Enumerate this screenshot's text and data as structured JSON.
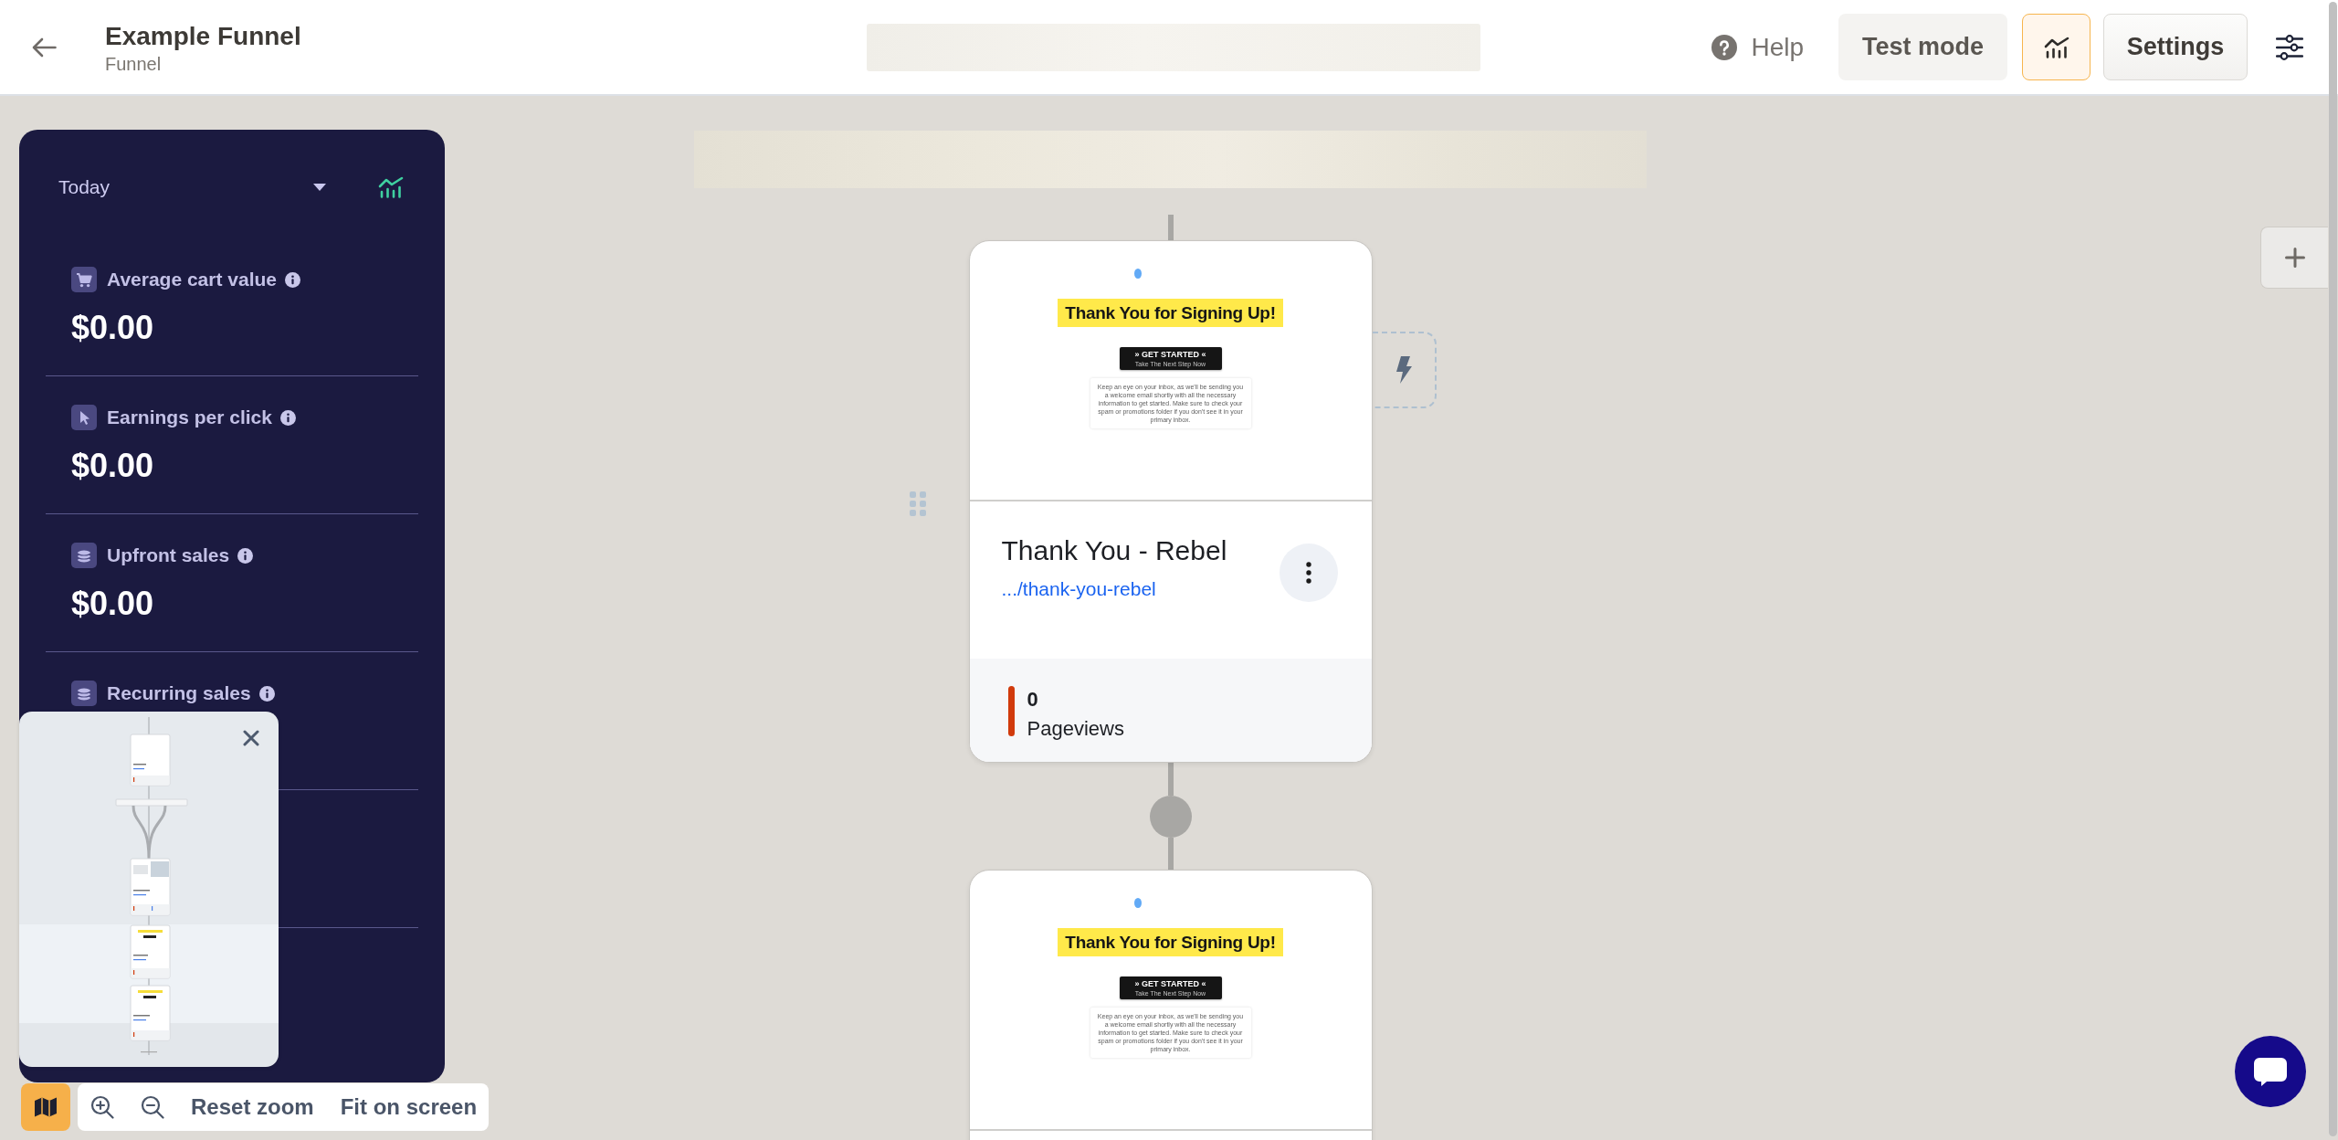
{
  "header": {
    "title": "Example Funnel",
    "subtitle": "Funnel",
    "actions": [
      {
        "kind": "help",
        "label": "Help"
      },
      {
        "kind": "test",
        "label": "Test mode"
      },
      {
        "kind": "analytics",
        "selected": true
      },
      {
        "kind": "settings",
        "label": "Settings"
      },
      {
        "kind": "adjust"
      }
    ]
  },
  "stats_panel": {
    "period": "Today",
    "metrics": [
      {
        "kind": "cart",
        "label": "Average cart value",
        "value": "$0.00"
      },
      {
        "kind": "click",
        "label": "Earnings per click",
        "value": "$0.00"
      },
      {
        "kind": "sales",
        "label": "Upfront sales",
        "value": "$0.00"
      },
      {
        "kind": "sales",
        "label": "Recurring sales"
      }
    ]
  },
  "funnel": {
    "steps": [
      {
        "preview": {
          "headline": "Thank You for Signing Up!",
          "button_label": "» GET STARTED «",
          "button_subtext": "Take The Next Step Now",
          "body": "Keep an eye on your inbox, as we'll be sending you a welcome email shortly with all the necessary information to get started. Make sure to check your spam or promotions folder if you don't see it in your primary inbox."
        },
        "title": "Thank You - Rebel",
        "url": ".../thank-you-rebel",
        "stats": [
          {
            "value": "0",
            "label": "Pageviews"
          }
        ]
      },
      {
        "preview": {
          "headline": "Thank You for Signing Up!",
          "button_label": "» GET STARTED «",
          "button_subtext": "Take The Next Step Now",
          "body": "Keep an eye on your inbox, as we'll be sending you a welcome email shortly with all the necessary information to get started. Make sure to check your spam or promotions folder if you don't see it in your primary inbox."
        }
      }
    ]
  },
  "canvas_controls": {
    "minimap_toggle": {
      "selected": true
    },
    "reset_label": "Reset zoom",
    "fit_label": "Fit on screen"
  }
}
